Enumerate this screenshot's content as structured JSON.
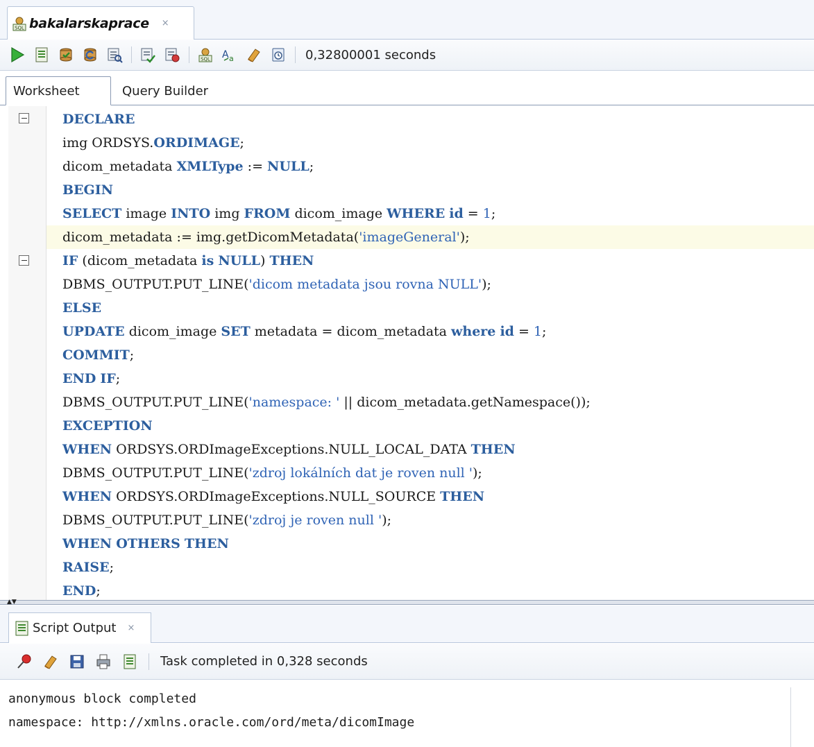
{
  "document_tab": {
    "title": "bakalarskaprace",
    "close": "×"
  },
  "toolbar": {
    "status": "0,32800001 seconds",
    "buttons": [
      "run-statement-icon",
      "run-script-icon",
      "commit-icon",
      "rollback-icon",
      "explain-plan-icon",
      "autotrace-icon",
      "sql-history-icon",
      "sql-icon",
      "format-icon",
      "clear-icon",
      "history-icon"
    ]
  },
  "worksheet_tabs": {
    "worksheet": "Worksheet",
    "query_builder": "Query Builder"
  },
  "editor": {
    "lines": [
      [
        "DECLARE"
      ],
      [
        "img ORDSYS.",
        "ORDIMAGE",
        ";"
      ],
      [
        "dicom_metadata ",
        "XMLType",
        " := ",
        "NULL",
        ";"
      ],
      [
        "BEGIN"
      ],
      [
        "SELECT",
        " image ",
        "INTO",
        " img ",
        "FROM",
        " dicom_image ",
        "WHERE",
        " ",
        "id",
        " = ",
        "1",
        ";"
      ],
      [
        "dicom_metadata := img.getDicomMetadata(",
        "'imageGeneral'",
        ");"
      ],
      [
        "IF",
        " (dicom_metadata ",
        "is",
        " ",
        "NULL",
        ") ",
        "THEN"
      ],
      [
        "DBMS_OUTPUT.PUT_LINE(",
        "'dicom metadata jsou rovna NULL'",
        ");"
      ],
      [
        "ELSE"
      ],
      [
        "UPDATE",
        " dicom_image ",
        "SET",
        " metadata = dicom_metadata ",
        "where",
        " ",
        "id",
        " = ",
        "1",
        ";"
      ],
      [
        "COMMIT",
        ";"
      ],
      [
        "END",
        " ",
        "IF",
        ";"
      ],
      [
        "DBMS_OUTPUT.PUT_LINE(",
        "'namespace: '",
        " || dicom_metadata.getNamespace());"
      ],
      [
        "EXCEPTION"
      ],
      [
        "WHEN",
        " ORDSYS.ORDImageExceptions.NULL_LOCAL_DATA ",
        "THEN"
      ],
      [
        "DBMS_OUTPUT.PUT_LINE(",
        "'zdroj lokálních dat je roven null '",
        ");"
      ],
      [
        "WHEN",
        " ORDSYS.ORDImageExceptions.NULL_SOURCE ",
        "THEN"
      ],
      [
        "DBMS_OUTPUT.PUT_LINE(",
        "'zdroj je roven null '",
        ");"
      ],
      [
        "WHEN",
        " ",
        "OTHERS",
        " ",
        "THEN"
      ],
      [
        "RAISE",
        ";"
      ],
      [
        "END",
        ";"
      ]
    ],
    "token_kinds": [
      [
        "kw"
      ],
      [
        "",
        "kw",
        ""
      ],
      [
        "",
        "kw",
        "",
        "kw",
        ""
      ],
      [
        "kw"
      ],
      [
        "kw",
        "",
        "kw",
        "",
        "kw",
        "",
        "kw",
        "",
        "kw",
        "",
        "num",
        ""
      ],
      [
        "",
        "str",
        ""
      ],
      [
        "kw",
        "",
        "kw",
        "",
        "kw",
        "",
        "kw"
      ],
      [
        "",
        "str",
        ""
      ],
      [
        "kw"
      ],
      [
        "kw",
        "",
        "kw",
        "",
        "kw",
        "",
        "kw",
        "",
        "num",
        ""
      ],
      [
        "kw",
        ""
      ],
      [
        "kw",
        "",
        "kw",
        ""
      ],
      [
        "",
        "str",
        ""
      ],
      [
        "kw"
      ],
      [
        "kw",
        "",
        "kw"
      ],
      [
        "",
        "str",
        ""
      ],
      [
        "kw",
        "",
        "kw"
      ],
      [
        "",
        "str",
        ""
      ],
      [
        "kw",
        "",
        "kw",
        "",
        "kw"
      ],
      [
        "kw",
        ""
      ],
      [
        "kw",
        ""
      ]
    ],
    "highlighted_line": 5
  },
  "output_panel": {
    "tab_title": "Script Output",
    "close": "×",
    "status": "Task completed in 0,328 seconds",
    "lines": [
      "anonymous block completed",
      "namespace: http://xmlns.oracle.com/ord/meta/dicomImage"
    ]
  },
  "colors": {
    "keyword": "#2c5e9e",
    "string": "#2f63b5",
    "highlight": "#fcfbe6"
  }
}
